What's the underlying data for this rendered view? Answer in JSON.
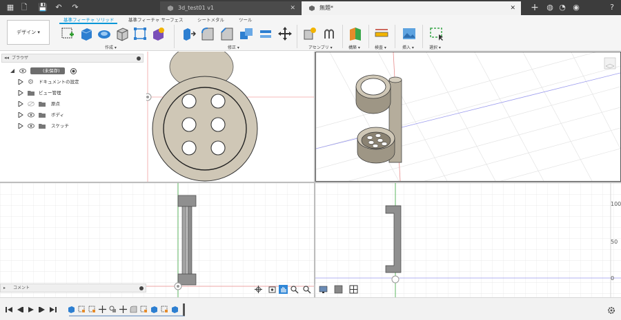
{
  "titlebar": {
    "tabs": [
      {
        "label": "3d_test01 v1"
      },
      {
        "label": "無題*"
      }
    ],
    "close_glyph": "✕",
    "plus_glyph": "+"
  },
  "ribbon": {
    "workspace_label": "デザイン ▾",
    "tabs": [
      "基準フィーチャ ソリッド",
      "基準フィーチャ サーフェス",
      "シートメタル",
      "ツール"
    ],
    "groups": [
      "作成 ▾",
      "修正 ▾",
      "アセンブリ ▾",
      "構築 ▾",
      "検査 ▾",
      "挿入 ▾",
      "選択 ▾"
    ]
  },
  "browser": {
    "title": "ブラウザ",
    "items": [
      {
        "label": "(未保存)"
      },
      {
        "label": "ドキュメントの設定"
      },
      {
        "label": "ビュー管理"
      },
      {
        "label": "原点"
      },
      {
        "label": "ボディ"
      },
      {
        "label": "スケッチ"
      }
    ]
  },
  "comment": {
    "label": "コメント"
  },
  "viewport_bottom_right": {
    "ruler_ticks": [
      "100",
      "50",
      "0"
    ]
  },
  "colors": {
    "accent": "#0696d7",
    "body_fill": "#d4ccbb",
    "titlebar_bg": "#3c3c3c",
    "selected_green": "#4caf50"
  }
}
